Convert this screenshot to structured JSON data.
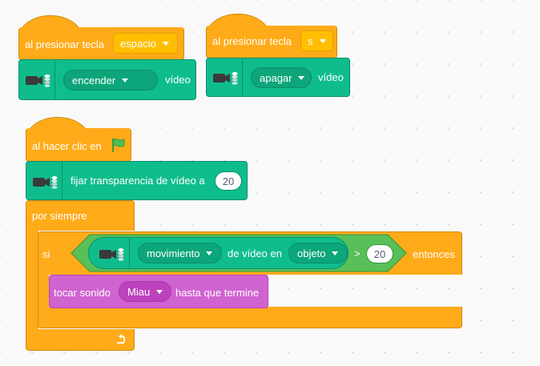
{
  "script1": {
    "hat_label": "al presionar tecla",
    "key_value": "espacio",
    "video_action": "encender",
    "video_suffix": "vídeo"
  },
  "script2": {
    "hat_label": "al presionar tecla",
    "key_value": "s",
    "video_action": "apagar",
    "video_suffix": "vídeo"
  },
  "script3": {
    "hat_label": "al hacer clic en",
    "transparency_label": "fijar transparencia de vídeo a",
    "transparency_value": "20",
    "forever_label": "por siempre",
    "if_label": "si",
    "motion_value": "movimiento",
    "motion_middle": "de vídeo en",
    "motion_target": "objeto",
    "compare_op": ">",
    "compare_value": "20",
    "then_label": "entonces",
    "sound_prefix": "tocar sonido",
    "sound_value": "Miau",
    "sound_suffix": "hasta que termine"
  },
  "icons": {
    "video": "video-camera-icon",
    "flag": "green-flag-icon",
    "loop": "loop-arrow-icon"
  },
  "colors": {
    "event": "#ffab19",
    "video": "#0fbd8c",
    "control": "#ffab19",
    "sound": "#cf63cf",
    "flag": "#4cbf56"
  }
}
